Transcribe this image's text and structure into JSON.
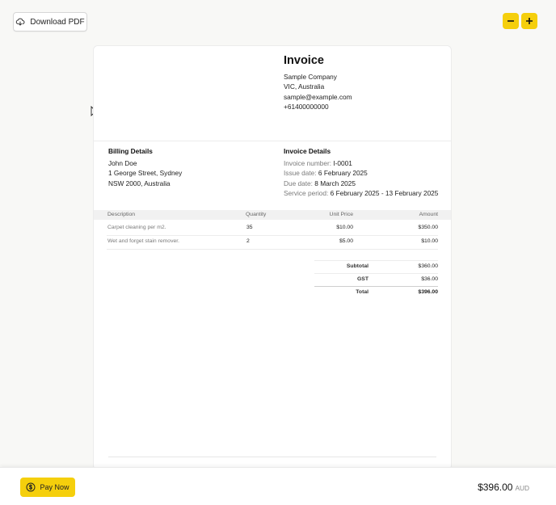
{
  "toolbar": {
    "download_label": "Download PDF",
    "download_icon": "cloud-download-icon",
    "zoom_out_icon": "minus-icon",
    "zoom_in_icon": "plus-icon",
    "accent_color": "#f5cf0c"
  },
  "invoice": {
    "title": "Invoice",
    "company": {
      "name": "Sample Company",
      "region": "VIC, Australia",
      "email": "sample@example.com",
      "phone": "+61400000000"
    },
    "billing": {
      "heading": "Billing Details",
      "name": "John Doe",
      "street": "1 George Street, Sydney",
      "city": "NSW 2000, Australia"
    },
    "details": {
      "heading": "Invoice Details",
      "number_label": "Invoice number:",
      "number": "I-0001",
      "issue_label": "Issue date:",
      "issue": "6 February 2025",
      "due_label": "Due date:",
      "due": "8 March 2025",
      "period_label": "Service period:",
      "period": "6 February 2025 - 13 February 2025"
    },
    "table": {
      "headers": [
        "Description",
        "Quantity",
        "Unit Price",
        "Amount"
      ],
      "rows": [
        {
          "description": "Carpet cleaning per m2.",
          "quantity": "35",
          "unit_price": "$10.00",
          "amount": "$350.00"
        },
        {
          "description": "Wet and forget stain remover.",
          "quantity": "2",
          "unit_price": "$5.00",
          "amount": "$10.00"
        }
      ]
    },
    "totals": {
      "subtotal_label": "Subtotal",
      "subtotal": "$360.00",
      "gst_label": "GST",
      "gst": "$36.00",
      "total_label": "Total",
      "total": "$396.00"
    }
  },
  "footer": {
    "pay_label": "Pay Now",
    "pay_icon": "dollar-coin-icon",
    "amount": "$396.00",
    "currency": "AUD"
  }
}
